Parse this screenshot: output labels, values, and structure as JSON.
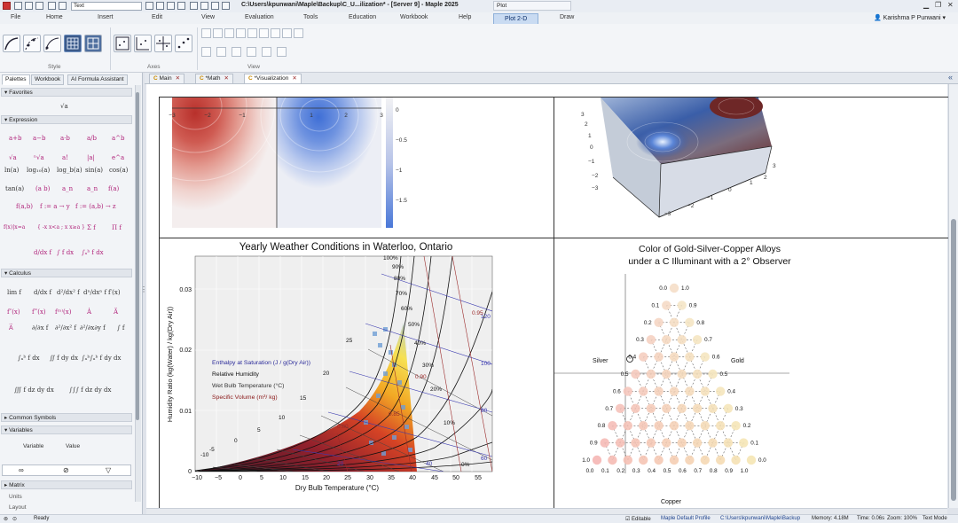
{
  "titlebar": {
    "style_value": "Text",
    "window_title": "C:\\Users\\kpunwani\\Maple\\Backup\\C_U...ilization* - [Server 9] - Maple 2025",
    "context_label": "Plot"
  },
  "menu": {
    "items": [
      "File",
      "Home",
      "Insert",
      "Edit",
      "View",
      "Evaluation",
      "Tools",
      "Education",
      "Workbook",
      "Help",
      "Plot 2-D",
      "Draw"
    ],
    "user": "Karishma P Punwani"
  },
  "ribbon": {
    "style_label": "Style",
    "axes_label": "Axes",
    "view_label": "View"
  },
  "left_panel": {
    "tabs": [
      "Palettes",
      "Workbook",
      "AI Formula Assistant"
    ],
    "sections": {
      "favorites": "Favorites",
      "expression": "Expression",
      "calculus": "Calculus",
      "common_symbols": "Common Symbols",
      "variables": "Variables",
      "matrix": "Matrix"
    },
    "favorites_items": [
      "√a"
    ],
    "expression_rows": [
      [
        "a+b",
        "a−b",
        "a·b",
        "a/b",
        "a^b"
      ],
      [
        "√a",
        "ⁿ√a",
        "a!",
        "|a|",
        "e^a"
      ],
      [
        "ln(a)",
        "log₁₀(a)",
        "log_b(a)",
        "sin(a)",
        "cos(a)"
      ],
      [
        "tan(a)",
        "(a b)",
        "a_n",
        "a_n",
        "f(a)"
      ],
      [
        "f(a,b)",
        "f := a → y",
        "f := (a,b) → z"
      ],
      [
        "f(x)|x=a",
        "{ -x x<a ; x x≥a }",
        "Σ f",
        "Π f"
      ],
      [
        "d/dx f",
        "∫ f dx",
        "∫ₐᵇ f dx"
      ]
    ],
    "calculus_rows": [
      [
        "lim f",
        "d/dx f",
        "d²/dx² f",
        "dⁿ/dxⁿ f",
        "f′(x)"
      ],
      [
        "f″(x)",
        "f‴(x)",
        "f⁽ⁿ⁾(x)",
        "Ȧ",
        "Ä"
      ],
      [
        "A⃛",
        "∂/∂x f",
        "∂²/∂x² f",
        "∂²/∂x∂y f",
        "∫ f"
      ],
      [
        "∫ₐᵇ f dx",
        "∬ f dy dx",
        "∫ₐᵇ∫ₐᵇ f dy dx"
      ],
      [
        "∭ f dz dy dx",
        "∫∫∫ f dz dy dx"
      ]
    ],
    "variables_columns": [
      "Variable",
      "Value"
    ],
    "lower_items": [
      "Matrix",
      "Units",
      "Layout"
    ]
  },
  "doc_tabs": [
    {
      "label": "Main",
      "active": false
    },
    {
      "label": "*Math",
      "active": false
    },
    {
      "label": "*Visualization",
      "active": true
    }
  ],
  "contour_plot": {
    "x_ticks": [
      "−3",
      "−2",
      "−1",
      "1",
      "2",
      "3"
    ],
    "colorbar_ticks": [
      "0",
      "−0.5",
      "−1",
      "−1.5"
    ]
  },
  "surface_plot": {
    "ticks": [
      "3",
      "2",
      "1",
      "0",
      "−1",
      "−2",
      "−3"
    ]
  },
  "psychrometric_chart": {
    "title": "Yearly Weather Conditions in Waterloo, Ontario",
    "xlabel": "Dry Bulb Temperature (°C)",
    "ylabel": "Humidity Ratio (kg(Water) / kg(Dry Air))",
    "x_ticks": [
      "−10",
      "−5",
      "0",
      "5",
      "10",
      "15",
      "20",
      "25",
      "30",
      "35",
      "40",
      "45",
      "50",
      "55"
    ],
    "y_ticks": [
      "0",
      "0.01",
      "0.02",
      "0.03"
    ],
    "legend": [
      {
        "label": "Enthalpy at Saturation (J / g(Dry Air))",
        "color": "#2b2b9a"
      },
      {
        "label": "Relative Humidity",
        "color": "#111111"
      },
      {
        "label": "Wet Bulb Temperature (°C)",
        "color": "#333333"
      },
      {
        "label": "Specific Volume (m³/ kg)",
        "color": "#8b1a1a"
      }
    ],
    "rh_labels": [
      "100%",
      "90%",
      "80%",
      "70%",
      "60%",
      "50%",
      "40%",
      "30%",
      "20%",
      "10%",
      "0%"
    ],
    "wet_bulb_labels": [
      "-10",
      "-5",
      "0",
      "5",
      "10",
      "15",
      "20",
      "25"
    ],
    "enthalpy_labels": [
      "120",
      "100",
      "80",
      "60",
      "40",
      "20"
    ],
    "volume_labels": [
      "0.95",
      "0.90",
      "0.85",
      "0.80"
    ]
  },
  "ternary_chart": {
    "title_line1": "Color of Gold-Silver-Copper Alloys",
    "title_line2": "under a C Illuminant with a 2° Observer",
    "vertex_labels": {
      "left": "Silver",
      "right": "Gold",
      "bottom": "Copper"
    },
    "left_axis_ticks": [
      "0.0",
      "0.1",
      "0.2",
      "0.3",
      "0.4",
      "0.5",
      "0.6",
      "0.7",
      "0.8",
      "0.9",
      "1.0"
    ],
    "right_axis_ticks": [
      "1.0",
      "0.9",
      "0.8",
      "0.7",
      "0.6",
      "0.5",
      "0.4",
      "0.3",
      "0.2",
      "0.1",
      "0.0"
    ],
    "bottom_axis_ticks": [
      "0.0",
      "0.1",
      "0.2",
      "0.3",
      "0.4",
      "0.5",
      "0.6",
      "0.7",
      "0.8",
      "0.9",
      "1.0"
    ]
  },
  "statusbar": {
    "editable": "Editable",
    "profile": "Maple Default Profile",
    "path": "C:\\Users\\kpunwani\\Maple\\Backup",
    "memory": "Memory: 4.18M",
    "time": "Time: 0.06s",
    "zoom": "Zoom: 100%",
    "mode": "Text Mode",
    "ready": "Ready"
  },
  "colors": {
    "accent": "#c9dbf2",
    "contour_red": "#c8453f",
    "contour_blue": "#4a78d8"
  }
}
